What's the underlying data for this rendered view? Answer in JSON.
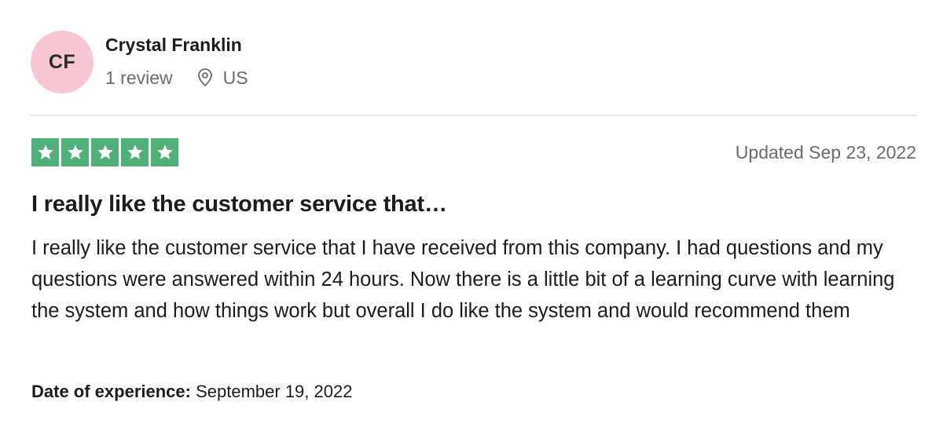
{
  "reviewer": {
    "initials": "CF",
    "name": "Crystal Franklin",
    "review_count": "1 review",
    "location_icon": "location-pin-icon",
    "country": "US",
    "avatar_color": "#f7c8d3"
  },
  "review": {
    "rating": 5,
    "rating_max": 5,
    "star_color": "#4fb078",
    "updated": "Updated Sep 23, 2022",
    "title": "I really like the customer service that…",
    "body": "I really like the customer service that I have received from this company. I had questions and my questions were answered within 24 hours. Now there is a little bit of a learning curve with learning the system and how things work but overall I do like the system and would recommend them",
    "experience_label": "Date of experience:",
    "experience_date": "September 19, 2022"
  }
}
